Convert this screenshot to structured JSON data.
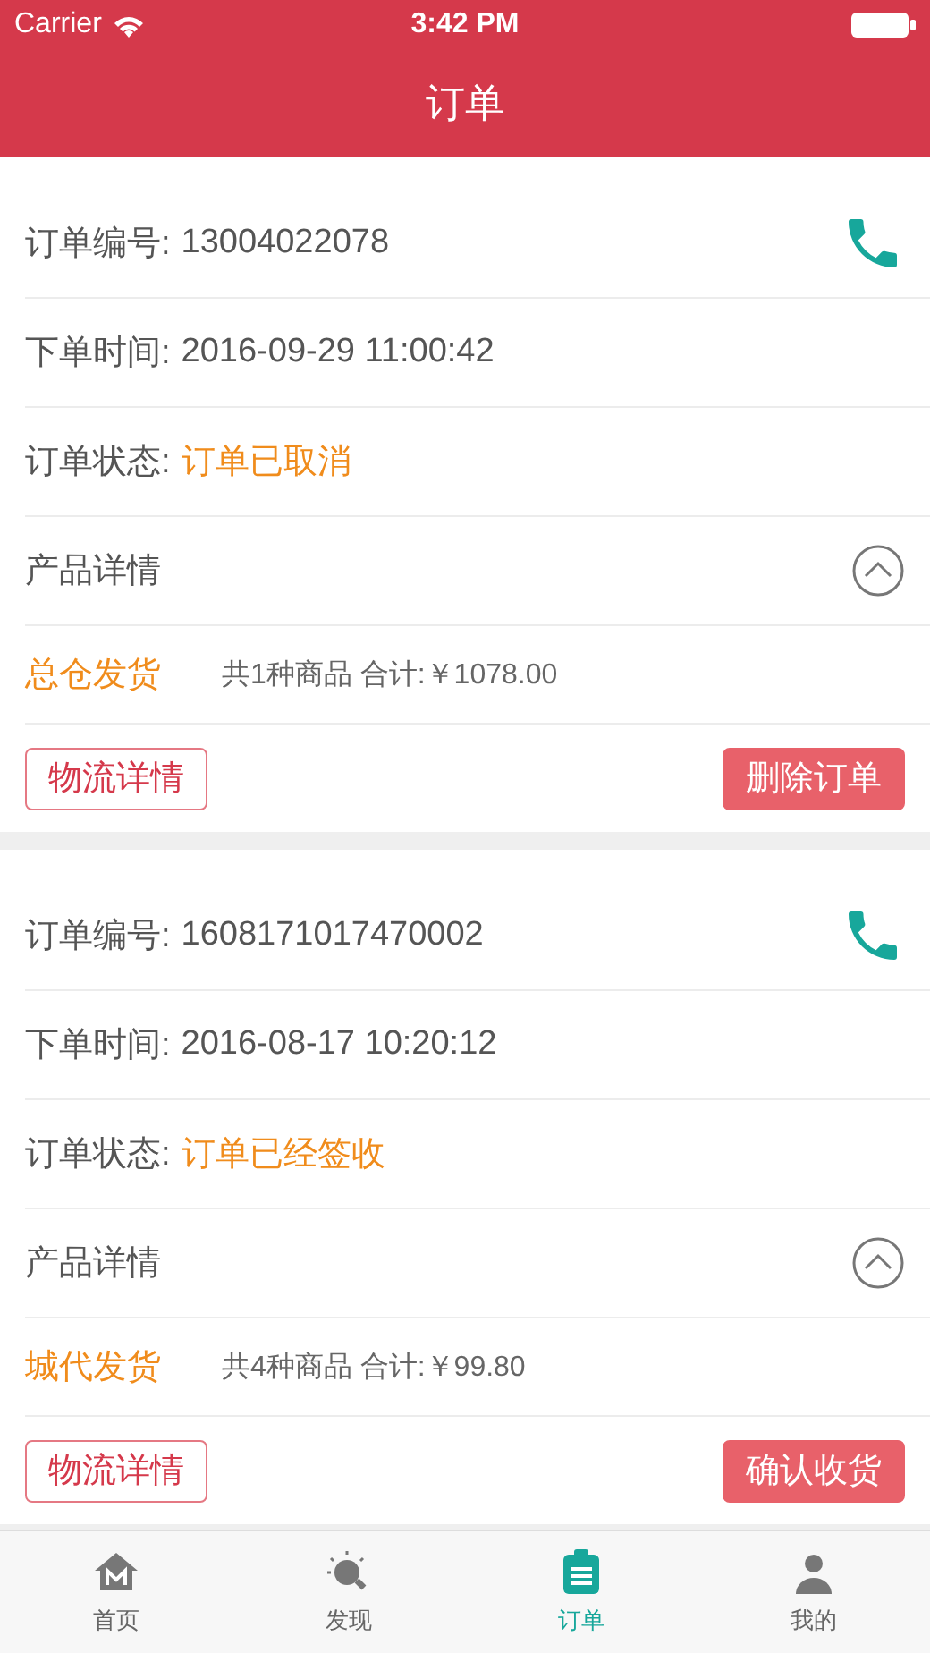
{
  "status_bar": {
    "carrier": "Carrier",
    "time": "3:42 PM"
  },
  "nav": {
    "title": "订单"
  },
  "orders": [
    {
      "fields": [
        {
          "label": "订单编号:",
          "value": "13004022078",
          "kind": "plain"
        },
        {
          "label": "下单时间:",
          "value": "2016-09-29 11:00:42",
          "kind": "plain"
        },
        {
          "label": "订单状态:",
          "value": "订单已取消",
          "kind": "status"
        }
      ],
      "details": {
        "label": "产品详情",
        "expanded": true
      },
      "source": "总仓发货",
      "summary": "共1种商品 合计:￥1078.00",
      "actions": [
        {
          "label": "物流详情",
          "kind": "outline"
        },
        {
          "label": "删除订单",
          "kind": "filled"
        }
      ]
    },
    {
      "fields": [
        {
          "label": "订单编号:",
          "value": "1608171017470002",
          "kind": "plain"
        },
        {
          "label": "下单时间:",
          "value": "2016-08-17 10:20:12",
          "kind": "plain"
        },
        {
          "label": "订单状态:",
          "value": "订单已经签收",
          "kind": "status"
        }
      ],
      "details": {
        "label": "产品详情",
        "expanded": true
      },
      "source": "城代发货",
      "summary": "共4种商品 合计:￥99.80",
      "actions": [
        {
          "label": "物流详情",
          "kind": "outline"
        },
        {
          "label": "确认收货",
          "kind": "filled"
        }
      ]
    }
  ],
  "tabs": [
    {
      "label": "首页",
      "kind": "home",
      "selected": false
    },
    {
      "label": "发现",
      "kind": "bulb",
      "selected": false
    },
    {
      "label": "订单",
      "kind": "clipboard",
      "selected": true
    },
    {
      "label": "我的",
      "kind": "user",
      "selected": false
    }
  ]
}
